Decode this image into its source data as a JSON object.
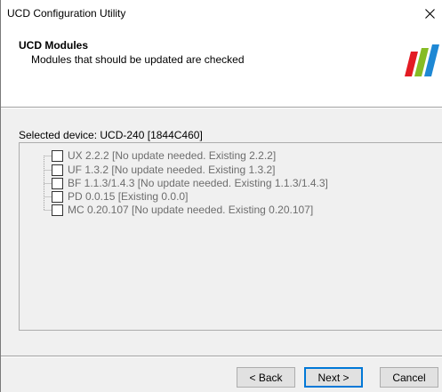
{
  "window": {
    "title": "UCD Configuration Utility",
    "close_glyph": "✕"
  },
  "header": {
    "title": "UCD Modules",
    "subtitle": "Modules that should be updated are checked",
    "logo_icon": "brand-stripes-icon",
    "logo_colors": [
      "#e31b23",
      "#86bc25",
      "#1e88d4"
    ]
  },
  "device": {
    "label": "Selected device: UCD-240 [1844C460]"
  },
  "modules": [
    {
      "label": "UX 2.2.2 [No update needed. Existing 2.2.2]",
      "checked": false
    },
    {
      "label": "UF 1.3.2 [No update needed. Existing 1.3.2]",
      "checked": false
    },
    {
      "label": "BF 1.1.3/1.4.3 [No update needed. Existing 1.1.3/1.4.3]",
      "checked": false
    },
    {
      "label": "PD 0.0.15 [Existing 0.0.0]",
      "checked": false
    },
    {
      "label": "MC 0.20.107 [No update needed. Existing 0.20.107]",
      "checked": false
    }
  ],
  "buttons": {
    "back": "< Back",
    "next": "Next >",
    "cancel": "Cancel"
  }
}
